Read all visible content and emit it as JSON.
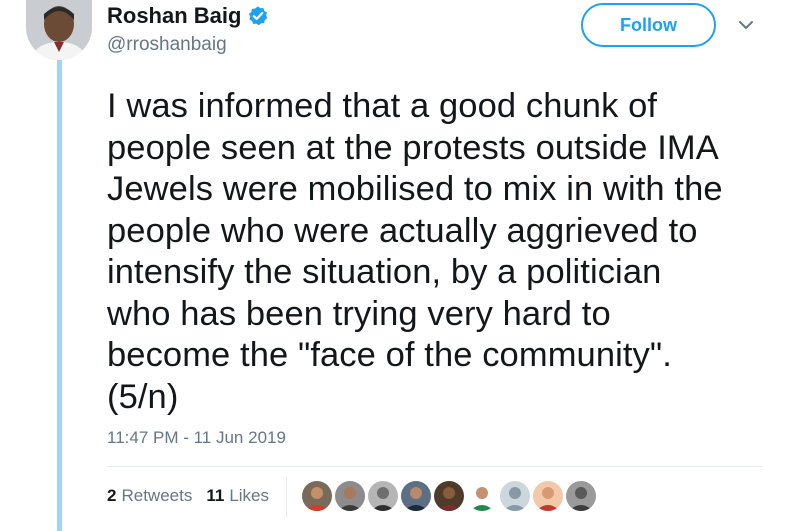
{
  "user": {
    "display_name": "Roshan Baig",
    "handle": "@rroshanbaig",
    "verified": true
  },
  "actions": {
    "follow_label": "Follow"
  },
  "tweet": {
    "lines": [
      "I was informed that a good chunk of",
      "people seen at the protests outside IMA",
      "Jewels were mobilised to mix in with the",
      "people who were actually aggrieved to",
      "intensify the situation, by a politician",
      "who has been trying very hard to",
      "become the \"face of the community\".",
      "(5/n)"
    ],
    "timestamp": "11:47 PM - 11 Jun 2019"
  },
  "stats": {
    "retweets_count": "2",
    "retweets_label": "Retweets",
    "likes_count": "11",
    "likes_label": "Likes"
  },
  "colors": {
    "accent": "#1da1f2",
    "thread_line": "#a0d5f2",
    "secondary_text": "#657786"
  },
  "icons": [
    "verified-badge-icon",
    "chevron-down-icon"
  ]
}
